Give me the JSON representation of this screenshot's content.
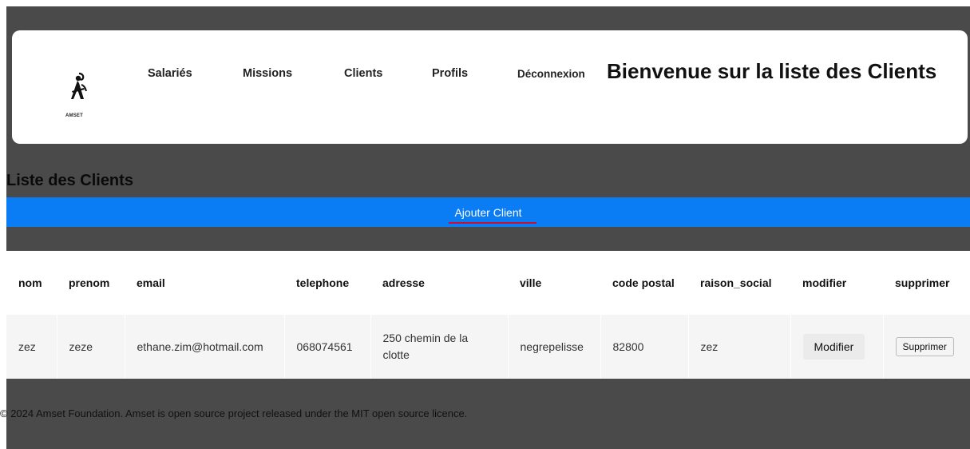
{
  "header": {
    "logo_text": "AMSET",
    "nav": [
      "Salariés",
      "Missions",
      "Clients",
      "Profils",
      "Déconnexion"
    ],
    "title": "Bienvenue sur la liste des Clients"
  },
  "section": {
    "title": "Liste des Clients",
    "add_button": "Ajouter Client"
  },
  "table": {
    "columns": [
      "nom",
      "prenom",
      "email",
      "telephone",
      "adresse",
      "ville",
      "code postal",
      "raison_social",
      "modifier",
      "supprimer"
    ],
    "rows": [
      {
        "nom": "zez",
        "prenom": "zeze",
        "email": "ethane.zim@hotmail.com",
        "telephone": "068074561",
        "adresse": "250 chemin de la clotte",
        "ville": "negrepelisse",
        "code_postal": "82800",
        "raison_social": "zez",
        "modifier_label": "Modifier",
        "supprimer_label": "Supprimer"
      }
    ]
  },
  "footer": {
    "text": "© 2024 Amset Foundation. Amset is open source project released under the MIT open source licence."
  },
  "colors": {
    "background": "#4a4a4a",
    "accent_bar": "#0a7df5",
    "underline": "#c8102e"
  }
}
